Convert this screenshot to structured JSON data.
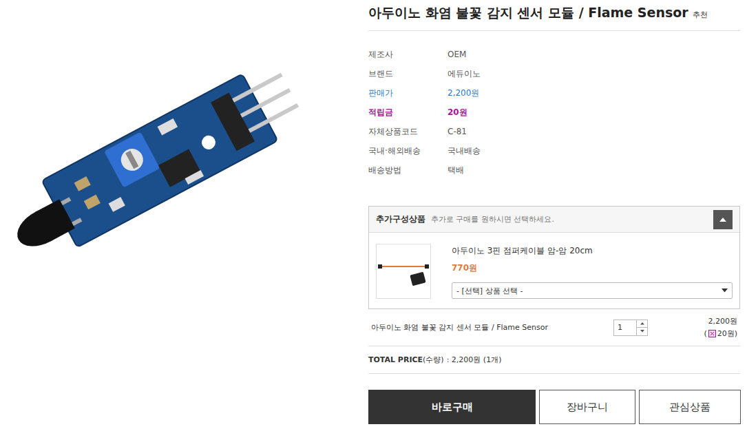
{
  "product": {
    "title": "아두이노 화염 불꽃 감지 센서 모듈 / Flame Sensor",
    "badge": "추천"
  },
  "info": [
    {
      "label": "제조사",
      "value": "OEM",
      "kind": "plain"
    },
    {
      "label": "브랜드",
      "value": "에듀이노",
      "kind": "plain"
    },
    {
      "label": "판매가",
      "value": "2,200원",
      "kind": "price"
    },
    {
      "label": "적립금",
      "value": "20원",
      "kind": "points"
    },
    {
      "label": "자체상품코드",
      "value": "C-81",
      "kind": "plain"
    },
    {
      "label": "국내·해외배송",
      "value": "국내배송",
      "kind": "plain"
    },
    {
      "label": "배송방법",
      "value": "택배",
      "kind": "plain"
    }
  ],
  "addon": {
    "title": "추가구성상품",
    "hint": "추가로 구매를 원하시면 선택하세요.",
    "expanded": true,
    "items": [
      {
        "name": "아두이노 3핀 점퍼케이블 암-암 20cm",
        "price": "770원",
        "select": "- [선택] 상품 선택 -"
      }
    ]
  },
  "order": {
    "name": "아두이노 화염 불꽃 감지 센서 모듈 / Flame Sensor",
    "quantity": "1",
    "price": "2,200원",
    "points_before": "(",
    "points_after": "20원)"
  },
  "total": {
    "label": "TOTAL PRICE",
    "qty_label": "(수량)",
    "value": ": 2,200원 (1개)"
  },
  "buttons": [
    {
      "label": "바로구매",
      "primary": true
    },
    {
      "label": "장바구니",
      "primary": false
    },
    {
      "label": "관심상품",
      "primary": false
    }
  ]
}
